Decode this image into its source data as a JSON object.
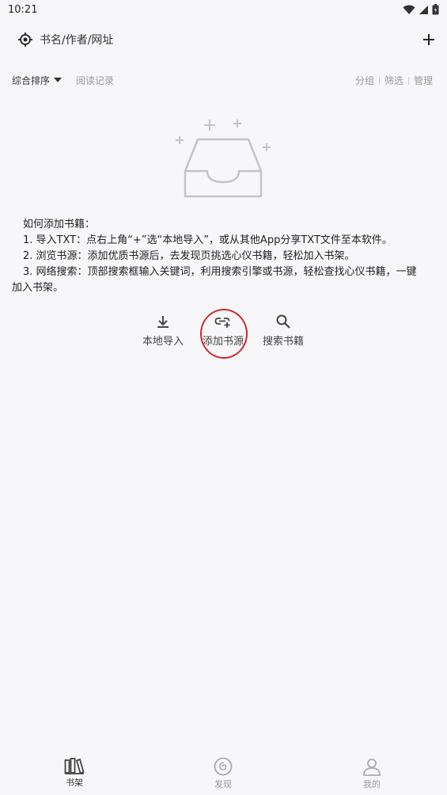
{
  "status_bar": {
    "time": "10:21"
  },
  "search": {
    "placeholder": "书名/作者/网址"
  },
  "sort_row": {
    "sort_label": "综合排序",
    "history_label": "阅读记录",
    "group_label": "分组",
    "filter_label": "筛选",
    "manage_label": "管理"
  },
  "howto": {
    "title": "如何添加书籍：",
    "line1": "1. 导入TXT：点右上角“+”选“本地导入”，或从其他App分享TXT文件至本软件。",
    "line2": "2. 浏览书源：添加优质书源后，去发现页挑选心仪书籍，轻松加入书架。",
    "line3a": "3. 网络搜索：顶部搜索框输入关键词，利用搜索引擎或书源，轻松查找心仪书籍，一键",
    "line3b": "加入书架。"
  },
  "actions": {
    "local_import": "本地导入",
    "add_source": "添加书源",
    "search_books": "搜索书籍"
  },
  "bottom_nav": {
    "shelf": "书架",
    "discover": "发现",
    "mine": "我的"
  },
  "colors": {
    "background": "#f7f7f9",
    "highlight": "#d0282e",
    "muted": "#999999"
  }
}
